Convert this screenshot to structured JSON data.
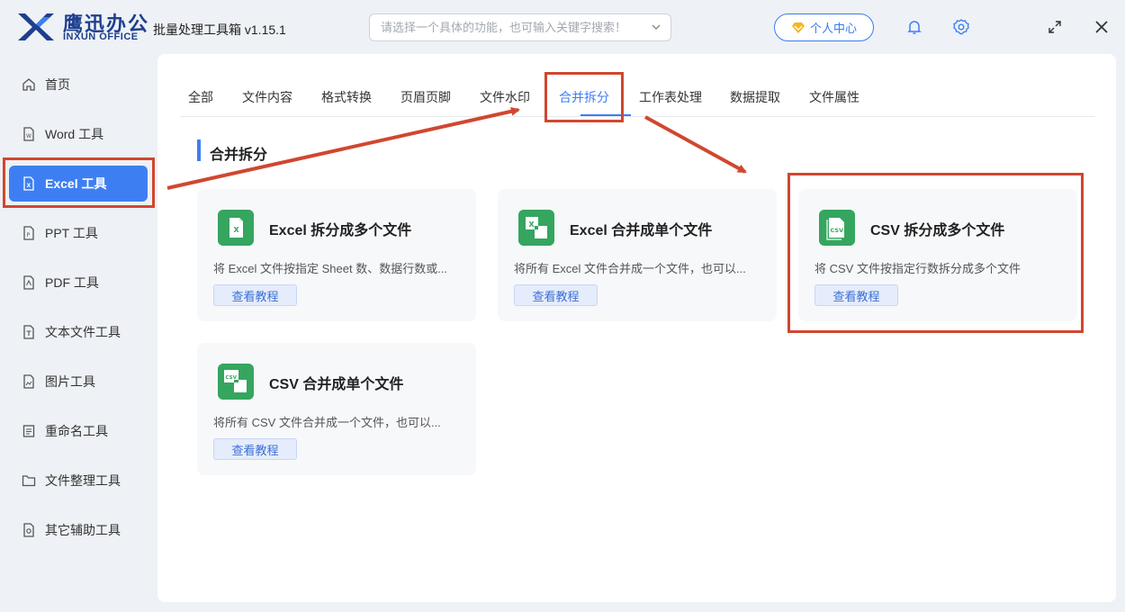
{
  "titlebar": {
    "logo_cn": "鹰迅办公",
    "logo_en": "INXUN OFFICE",
    "app_title": "批量处理工具箱 v1.15.1",
    "search_placeholder": "请选择一个具体的功能，也可输入关键字搜索！",
    "user_center": "个人中心",
    "icons": [
      "bell-icon",
      "gear-icon",
      "maximize-icon",
      "close-icon"
    ]
  },
  "sidebar": {
    "items": [
      {
        "label": "首页",
        "icon": "home-icon"
      },
      {
        "label": "Word 工具",
        "icon": "word-file-icon"
      },
      {
        "label": "Excel 工具",
        "icon": "excel-file-icon",
        "active": true
      },
      {
        "label": "PPT 工具",
        "icon": "ppt-file-icon"
      },
      {
        "label": "PDF 工具",
        "icon": "pdf-file-icon"
      },
      {
        "label": "文本文件工具",
        "icon": "text-file-icon"
      },
      {
        "label": "图片工具",
        "icon": "image-file-icon"
      },
      {
        "label": "重命名工具",
        "icon": "rename-icon"
      },
      {
        "label": "文件整理工具",
        "icon": "folder-icon"
      },
      {
        "label": "其它辅助工具",
        "icon": "tools-icon"
      }
    ]
  },
  "tabs": [
    {
      "label": "全部"
    },
    {
      "label": "文件内容"
    },
    {
      "label": "格式转换"
    },
    {
      "label": "页眉页脚"
    },
    {
      "label": "文件水印"
    },
    {
      "label": "合并拆分",
      "active": true
    },
    {
      "label": "工作表处理"
    },
    {
      "label": "数据提取"
    },
    {
      "label": "文件属性"
    }
  ],
  "section": {
    "title": "合并拆分"
  },
  "cards": [
    {
      "title": "Excel 拆分成多个文件",
      "desc": "将 Excel 文件按指定 Sheet 数、数据行数或...",
      "button": "查看教程",
      "icon": "excel-split-icon"
    },
    {
      "title": "Excel 合并成单个文件",
      "desc": "将所有 Excel 文件合并成一个文件，也可以...",
      "button": "查看教程",
      "icon": "excel-merge-icon"
    },
    {
      "title": "CSV 拆分成多个文件",
      "desc": "将 CSV 文件按指定行数拆分成多个文件",
      "button": "查看教程",
      "icon": "csv-split-icon"
    },
    {
      "title": "CSV 合并成单个文件",
      "desc": "将所有 CSV 文件合并成一个文件，也可以...",
      "button": "查看教程",
      "icon": "csv-merge-icon"
    }
  ],
  "colors": {
    "accent": "#3d7ff3",
    "annotation": "#d0472f",
    "icon_green": "#35a55f",
    "brand": "#1d3f8f"
  }
}
